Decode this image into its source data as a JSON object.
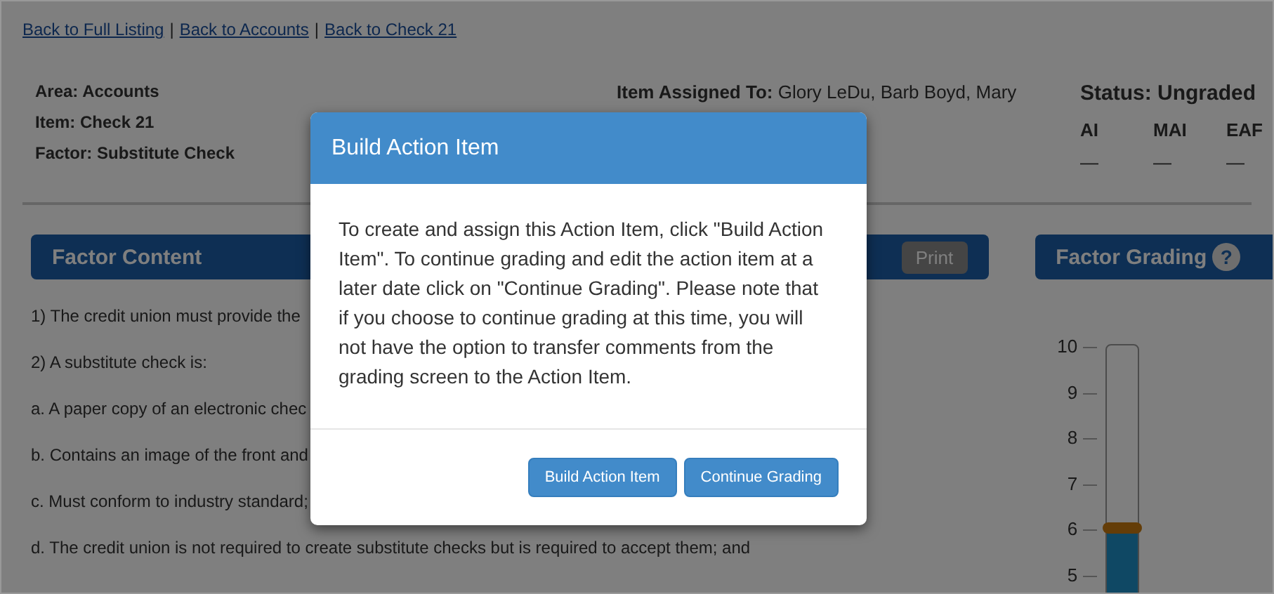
{
  "breadcrumbs": [
    {
      "label": "Back to Full Listing"
    },
    {
      "label": "Back to Accounts"
    },
    {
      "label": "Back to Check 21"
    }
  ],
  "breadcrumb_separator": "|",
  "details": [
    "Area: Accounts",
    "Item: Check 21",
    "Factor: Substitute Check"
  ],
  "assigned": {
    "label": "Item Assigned To:",
    "value": "Glory LeDu, Barb Boyd, Mary"
  },
  "status": {
    "title": "Status: Ungraded",
    "columns": [
      {
        "label": "AI",
        "value": "—"
      },
      {
        "label": "MAI",
        "value": "—"
      },
      {
        "label": "EAF",
        "value": "—"
      }
    ]
  },
  "factor_content": {
    "title": "Factor Content",
    "print_button": "Print",
    "lines": [
      "1) The credit union must provide the",
      "2) A substitute check is:",
      "a. A paper copy of an electronic chec",
      "b. Contains an image of the front and",
      "c. Must conform to industry standard;",
      "d. The credit union is not required to create substitute checks but is required to accept them; and"
    ]
  },
  "factor_grading": {
    "title": "Factor Grading",
    "help": "?",
    "slider": {
      "ticks": [
        "10",
        "9",
        "8",
        "7",
        "6",
        "5"
      ],
      "level": 0.6
    }
  },
  "dialog": {
    "title": "Build Action Item",
    "message": "To create and assign this Action Item, click \"Build Action Item\". To continue grading and edit the action item at a later date click on \"Continue Grading\". Please note that if you choose to continue grading at this time, you will not have the option to transfer comments from the grading screen to the Action Item.",
    "buttons": [
      "Build Action Item",
      "Continue Grading"
    ]
  }
}
